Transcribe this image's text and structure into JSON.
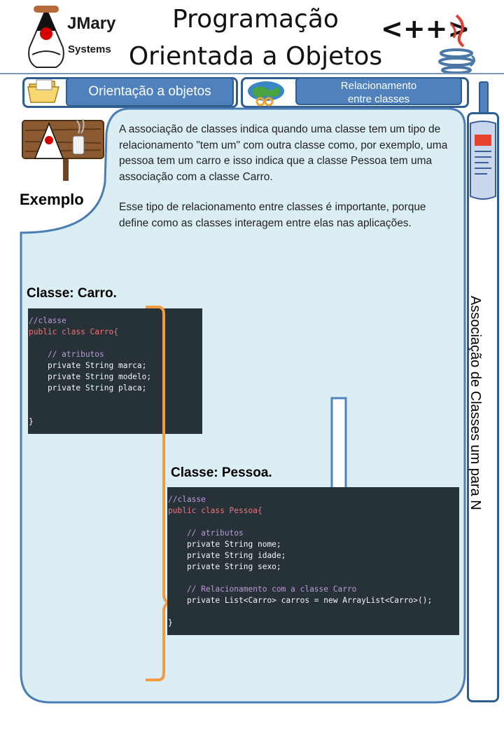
{
  "header": {
    "brand_line1": "JMary",
    "brand_line2": "Systems",
    "title_line1": "Programação",
    "title_line2": "Orientada a Objetos",
    "logo_text": "<++>"
  },
  "nav": {
    "tab1_label": "Orientação a objetos",
    "tab2_label_line1": "Relacionamento",
    "tab2_label_line2": "entre classes"
  },
  "side": {
    "label": "Associação de Classes um para N"
  },
  "content": {
    "exemplo_label": "Exemplo",
    "paragraph1": "A associação de classes indica quando uma classe tem um tipo de relacionamento \"tem um\" com outra classe como, por exemplo, uma pessoa tem um carro e isso indica que a classe Pessoa tem uma associação com a classe Carro.",
    "paragraph2": "Esse tipo de relacionamento entre classes é importante, porque define como as classes interagem entre elas nas aplicações.",
    "carro_title": "Classe: Carro.",
    "pessoa_title": "Classe: Pessoa."
  },
  "code": {
    "carro": [
      "//classe",
      "public class Carro{",
      "",
      "    // atributos",
      "    private String marca;",
      "    private String modelo;",
      "    private String placa;",
      "",
      "",
      "}"
    ],
    "pessoa": [
      "//classe",
      "public class Pessoa{",
      "",
      "    // atributos",
      "    private String nome;",
      "    private String idade;",
      "    private String sexo;",
      "",
      "    // Relacionamento com a classe Carro",
      "    private List<Carro> carros = new ArrayList<Carro>();",
      "",
      "}"
    ]
  },
  "colors": {
    "accent_blue": "#4f81bd",
    "frame_blue": "#2e5d8f",
    "panel_fill": "#dbeef4",
    "bracket_orange": "#f39a45",
    "code_bg": "#263238"
  },
  "icons": [
    "duke-mascot-icon",
    "folder-icon",
    "globe-icon",
    "newspaper-icon",
    "java-cup-icon",
    "down-arrow-icon",
    "bracket-icon"
  ]
}
